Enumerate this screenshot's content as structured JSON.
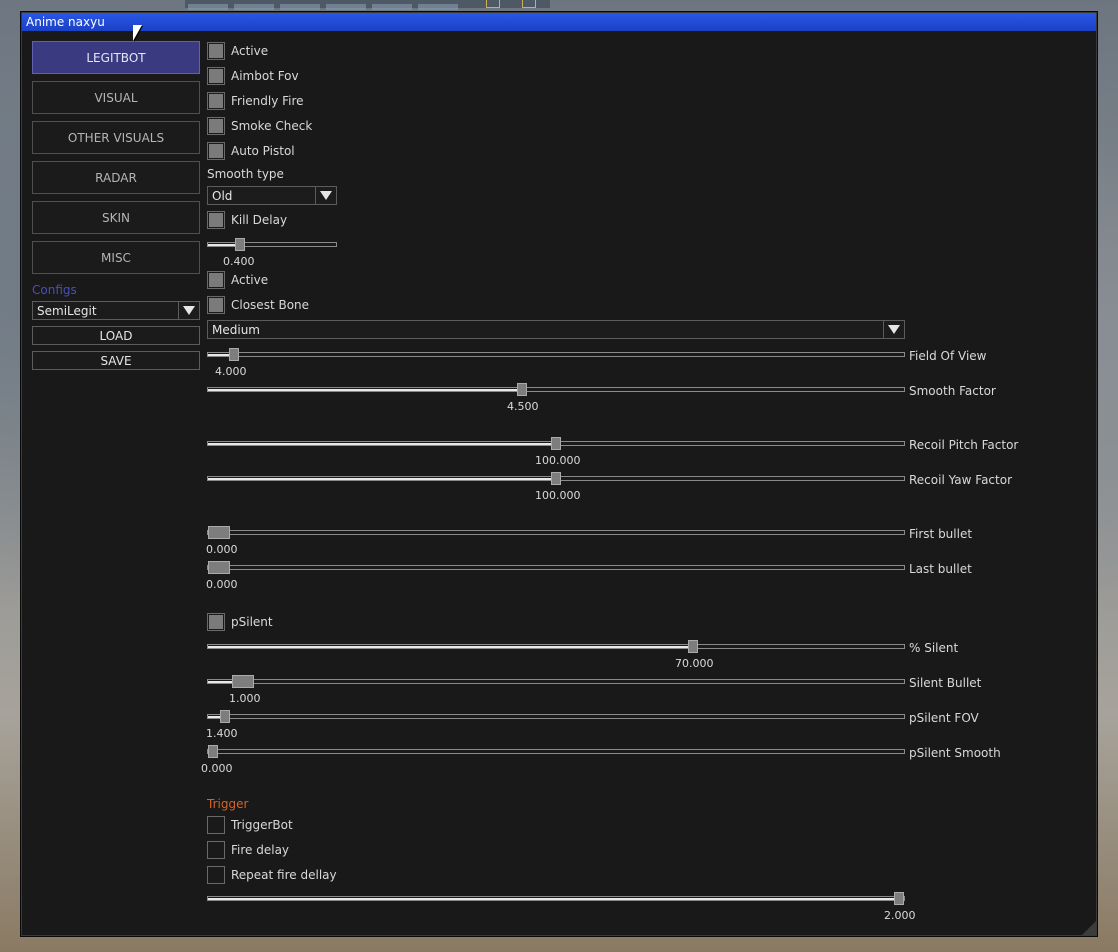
{
  "window": {
    "title": "Anime naxyu"
  },
  "nav": {
    "items": [
      "LEGITBOT",
      "VISUAL",
      "OTHER VISUALS",
      "RADAR",
      "SKIN",
      "MISC"
    ],
    "active": "LEGITBOT"
  },
  "configs": {
    "label": "Configs",
    "selected": "SemiLegit",
    "load_label": "LOAD",
    "save_label": "SAVE"
  },
  "general": {
    "checkboxes": [
      {
        "label": "Active",
        "checked": true
      },
      {
        "label": "Aimbot Fov",
        "checked": true
      },
      {
        "label": "Friendly Fire",
        "checked": true
      },
      {
        "label": "Smoke Check",
        "checked": true
      },
      {
        "label": "Auto Pistol",
        "checked": true
      }
    ],
    "smooth_type_label": "Smooth type",
    "smooth_type_value": "Old",
    "kill_delay": {
      "label": "Kill Delay",
      "checked": true,
      "value": "0.400",
      "fraction": 0.23
    }
  },
  "aim": {
    "checkboxes": [
      {
        "label": "Active",
        "checked": true
      },
      {
        "label": "Closest Bone",
        "checked": true
      }
    ],
    "bone_select": "Medium",
    "sliders": [
      {
        "label": "Field Of View",
        "value": "4.000",
        "fraction": 0.03
      },
      {
        "label": "Smooth Factor",
        "value": "4.500",
        "fraction": 0.45
      },
      {
        "label": "Recoil Pitch Factor",
        "value": "100.000",
        "fraction": 0.5
      },
      {
        "label": "Recoil Yaw Factor",
        "value": "100.000",
        "fraction": 0.5
      },
      {
        "label": "First bullet",
        "value": "0.000",
        "fraction": 0.0
      },
      {
        "label": "Last bullet",
        "value": "0.000",
        "fraction": 0.0
      }
    ]
  },
  "psilent": {
    "checkbox": {
      "label": "pSilent",
      "checked": true
    },
    "sliders": [
      {
        "label": "% Silent",
        "value": "70.000",
        "fraction": 0.7
      },
      {
        "label": "Silent Bullet",
        "value": "1.000",
        "fraction": 0.035
      },
      {
        "label": "pSilent FOV",
        "value": "1.400",
        "fraction": 0.018
      },
      {
        "label": "pSilent Smooth",
        "value": "0.000",
        "fraction": 0.0
      }
    ]
  },
  "trigger": {
    "title": "Trigger",
    "checkboxes": [
      {
        "label": "TriggerBot",
        "checked": false
      },
      {
        "label": "Fire delay",
        "checked": false
      },
      {
        "label": "Repeat fire dellay",
        "checked": false
      }
    ],
    "slider": {
      "value": "2.000",
      "fraction": 1.0
    }
  },
  "colors": {
    "titlebar": "#1e4ad3",
    "active_tab": "#3a3a80",
    "configs_label": "#4b4fb8",
    "trigger_label": "#d2642a",
    "panel_bg": "#191919"
  }
}
